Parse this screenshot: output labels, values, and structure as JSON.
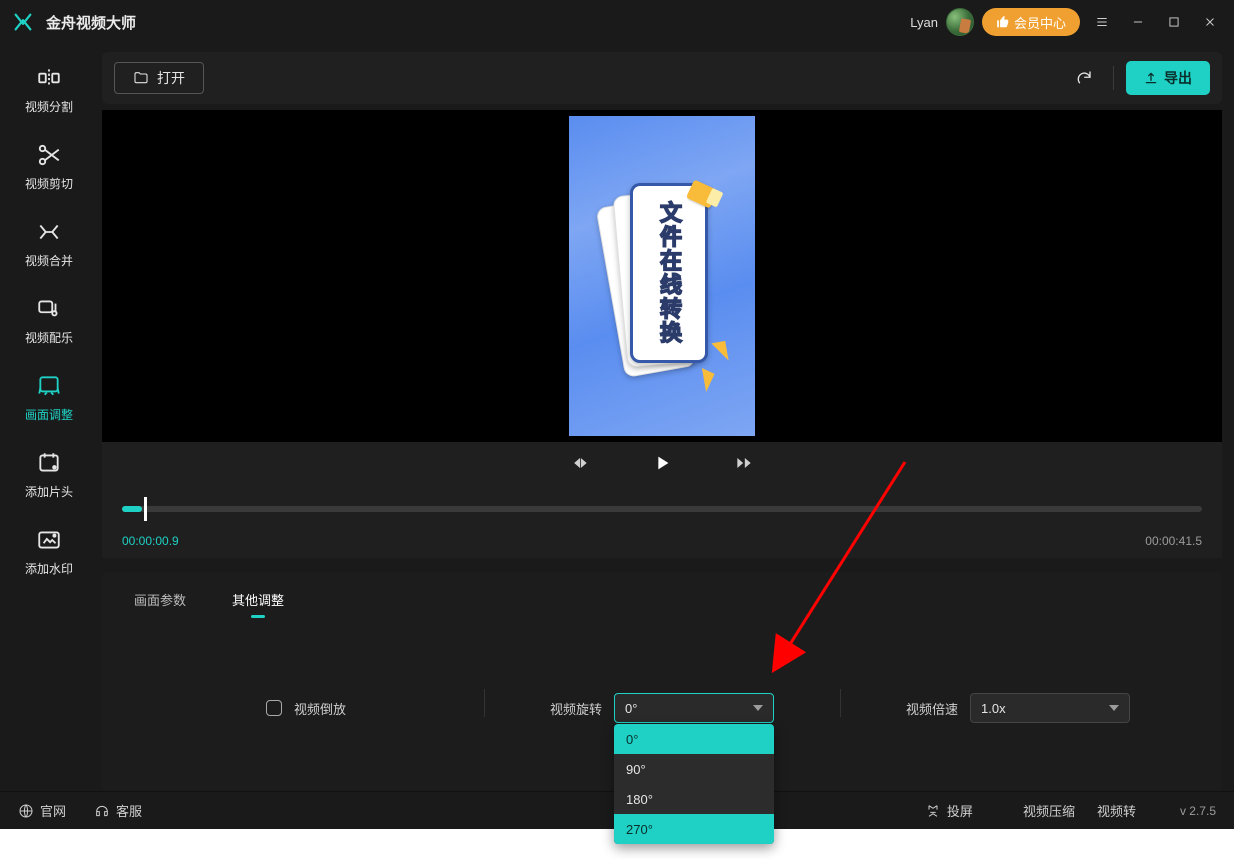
{
  "app": {
    "title": "金舟视频大师",
    "username": "Lyan",
    "vip_label": "会员中心"
  },
  "sidebar": {
    "items": [
      {
        "label": "视频分割"
      },
      {
        "label": "视频剪切"
      },
      {
        "label": "视频合并"
      },
      {
        "label": "视频配乐"
      },
      {
        "label": "画面调整"
      },
      {
        "label": "添加片头"
      },
      {
        "label": "添加水印"
      }
    ]
  },
  "toolbar": {
    "open_label": "打开",
    "export_label": "导出"
  },
  "preview": {
    "card_text": "文件在线转换"
  },
  "timeline": {
    "current": "00:00:00.9",
    "total": "00:00:41.5"
  },
  "params": {
    "tabs": [
      {
        "label": "画面参数"
      },
      {
        "label": "其他调整"
      }
    ],
    "reverse_label": "视频倒放",
    "rotate_label": "视频旋转",
    "rotate_value": "0°",
    "rotate_options": [
      "0°",
      "90°",
      "180°",
      "270°"
    ],
    "speed_label": "视频倍速",
    "speed_value": "1.0x"
  },
  "footer": {
    "site_label": "官网",
    "support_label": "客服",
    "cast_label": "投屏",
    "compress_label": "视频压缩",
    "convert_label": "视频转",
    "version": "v 2.7.5"
  }
}
